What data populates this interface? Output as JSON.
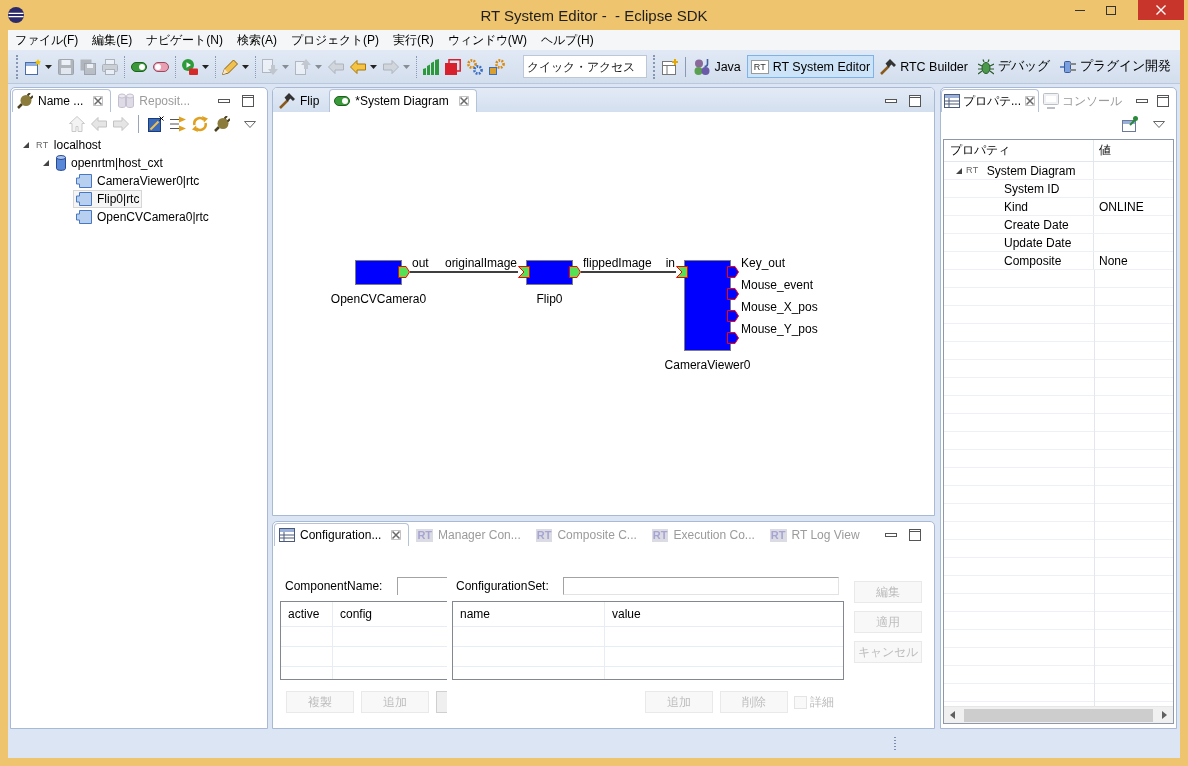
{
  "window": {
    "title": "RT System Editor -  - Eclipse SDK"
  },
  "menu": [
    "ファイル(F)",
    "編集(E)",
    "ナビゲート(N)",
    "検索(A)",
    "プロジェクト(P)",
    "実行(R)",
    "ウィンドウ(W)",
    "ヘルプ(H)"
  ],
  "toolbar": {
    "groups": [
      {
        "items": [
          {
            "disabled": false,
            "dropdown": true
          },
          {
            "disabled": true,
            "dropdown": false
          },
          {
            "disabled": true,
            "dropdown": false
          },
          {
            "disabled": true,
            "dropdown": false
          }
        ]
      },
      {
        "items": [
          {
            "disabled": false,
            "dropdown": false
          },
          {
            "disabled": false,
            "dropdown": false
          }
        ]
      },
      {
        "items": [
          {
            "disabled": false,
            "dropdown": true
          }
        ]
      },
      {
        "items": [
          {
            "disabled": false,
            "dropdown": true
          }
        ]
      },
      {
        "items": [
          {
            "disabled": true,
            "dropdown": true
          },
          {
            "disabled": true,
            "dropdown": true
          },
          {
            "disabled": true,
            "dropdown": false
          },
          {
            "disabled": false,
            "dropdown": true
          },
          {
            "disabled": true,
            "dropdown": true
          }
        ]
      },
      {
        "items": [
          {
            "disabled": false,
            "dropdown": false
          },
          {
            "disabled": false,
            "dropdown": false
          },
          {
            "disabled": false,
            "dropdown": false
          },
          {
            "disabled": false,
            "dropdown": false
          }
        ]
      }
    ],
    "quick_access": {
      "placeholder": "クイック・アクセス"
    }
  },
  "perspectives": [
    {
      "label": "Java",
      "selected": false
    },
    {
      "label": "RT System Editor",
      "badge": "RT",
      "selected": true
    },
    {
      "label": "RTC Builder",
      "selected": false
    },
    {
      "label": "デバッグ",
      "selected": false
    },
    {
      "label": "プラグイン開発",
      "selected": false
    }
  ],
  "name_service_view": {
    "tabs": [
      {
        "label": "Name ...",
        "selected": true
      },
      {
        "label": "Reposit...",
        "selected": false
      }
    ],
    "toolbar": [
      {
        "disabled": true
      },
      {
        "disabled": true
      },
      {
        "disabled": true
      },
      {
        "disabled": false
      },
      {
        "disabled": false
      },
      {
        "disabled": false
      },
      {
        "disabled": false
      }
    ],
    "tree": [
      {
        "kind": "host",
        "badge": "RT",
        "label": "localhost",
        "expanded": true,
        "selected": false,
        "children": [
          {
            "kind": "naming_context",
            "label": "openrtm|host_cxt",
            "expanded": true,
            "selected": false,
            "children": [
              {
                "kind": "component",
                "label": "CameraViewer0|rtc",
                "selected": false
              },
              {
                "kind": "component",
                "label": "Flip0|rtc",
                "selected": true
              },
              {
                "kind": "component",
                "label": "OpenCVCamera0|rtc",
                "selected": false
              }
            ]
          }
        ]
      }
    ]
  },
  "editor": {
    "tabs": [
      {
        "label": "Flip",
        "selected": false
      },
      {
        "label": "*System Diagram",
        "selected": true
      }
    ],
    "diagram": {
      "components": [
        {
          "name": "OpenCVCamera0",
          "out_ports": [
            {
              "name": "out",
              "connected": true
            }
          ]
        },
        {
          "name": "Flip0",
          "in_ports": [
            {
              "name": "originalImage",
              "connected": true
            }
          ],
          "out_ports": [
            {
              "name": "flippedImage",
              "connected": true
            }
          ]
        },
        {
          "name": "CameraViewer0",
          "in_ports": [
            {
              "name": "in",
              "connected": true
            }
          ],
          "out_ports": [
            {
              "name": "Key_out",
              "connected": false
            },
            {
              "name": "Mouse_event",
              "connected": false
            },
            {
              "name": "Mouse_X_pos",
              "connected": false
            },
            {
              "name": "Mouse_Y_pos",
              "connected": false
            }
          ]
        }
      ]
    }
  },
  "bottom_view": {
    "tabs": [
      {
        "label": "Configuration...",
        "selected": true
      },
      {
        "label": "Manager Con...",
        "badge": "RT",
        "selected": false
      },
      {
        "label": "Composite C...",
        "badge": "RT",
        "selected": false
      },
      {
        "label": "Execution Co...",
        "badge": "RT",
        "selected": false
      },
      {
        "label": "RT Log View",
        "badge": "RT",
        "selected": false
      }
    ],
    "configuration": {
      "component_name": {
        "label": "ComponentName:"
      },
      "configuration_set": {
        "label": "ConfigurationSet:"
      },
      "sets_table": {
        "columns": [
          "active",
          "config"
        ]
      },
      "params_table": {
        "columns": [
          "name",
          "value"
        ]
      },
      "set_buttons": [
        {
          "label": "複製",
          "disabled": true
        },
        {
          "label": "追加",
          "disabled": true
        }
      ],
      "param_buttons": [
        {
          "label": "追加",
          "disabled": true
        },
        {
          "label": "削除",
          "disabled": true
        }
      ],
      "detail_checkbox": {
        "label": "詳細",
        "checked": false,
        "disabled": true
      },
      "side_buttons": [
        {
          "label": "編集",
          "disabled": true
        },
        {
          "label": "適用",
          "disabled": true
        },
        {
          "label": "キャンセル",
          "disabled": true
        }
      ]
    }
  },
  "properties_view": {
    "tabs": [
      {
        "label": "プロパテ...",
        "selected": true
      },
      {
        "label": "コンソール",
        "selected": false
      }
    ],
    "columns": [
      "プロパティ",
      "値"
    ],
    "rows": [
      {
        "property": "System Diagram",
        "badge": "RT",
        "expanded": true,
        "children": [
          {
            "property": "System ID"
          },
          {
            "property": "Kind",
            "value": "ONLINE"
          },
          {
            "property": "Create Date"
          },
          {
            "property": "Update Date"
          },
          {
            "property": "Composite",
            "value": "None"
          }
        ]
      }
    ]
  }
}
